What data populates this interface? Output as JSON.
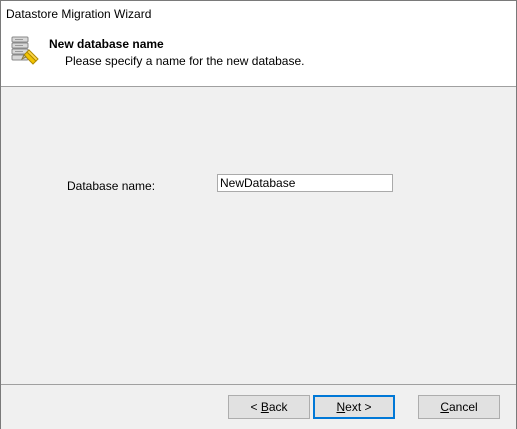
{
  "window": {
    "title": "Datastore Migration Wizard"
  },
  "header": {
    "icon": "database-icon",
    "title": "New database name",
    "subtitle": "Please specify a name for the new database."
  },
  "form": {
    "label": "Database name:",
    "value": "NewDatabase"
  },
  "buttons": {
    "back": {
      "prefix": "< ",
      "mnemonic": "B",
      "rest": "ack"
    },
    "next": {
      "mnemonic": "N",
      "rest": "ext >"
    },
    "cancel": {
      "mnemonic": "C",
      "rest": "ancel"
    }
  },
  "colors": {
    "background": "#f0f0f0",
    "header_bg": "#ffffff",
    "default_button_border": "#0078d7"
  }
}
